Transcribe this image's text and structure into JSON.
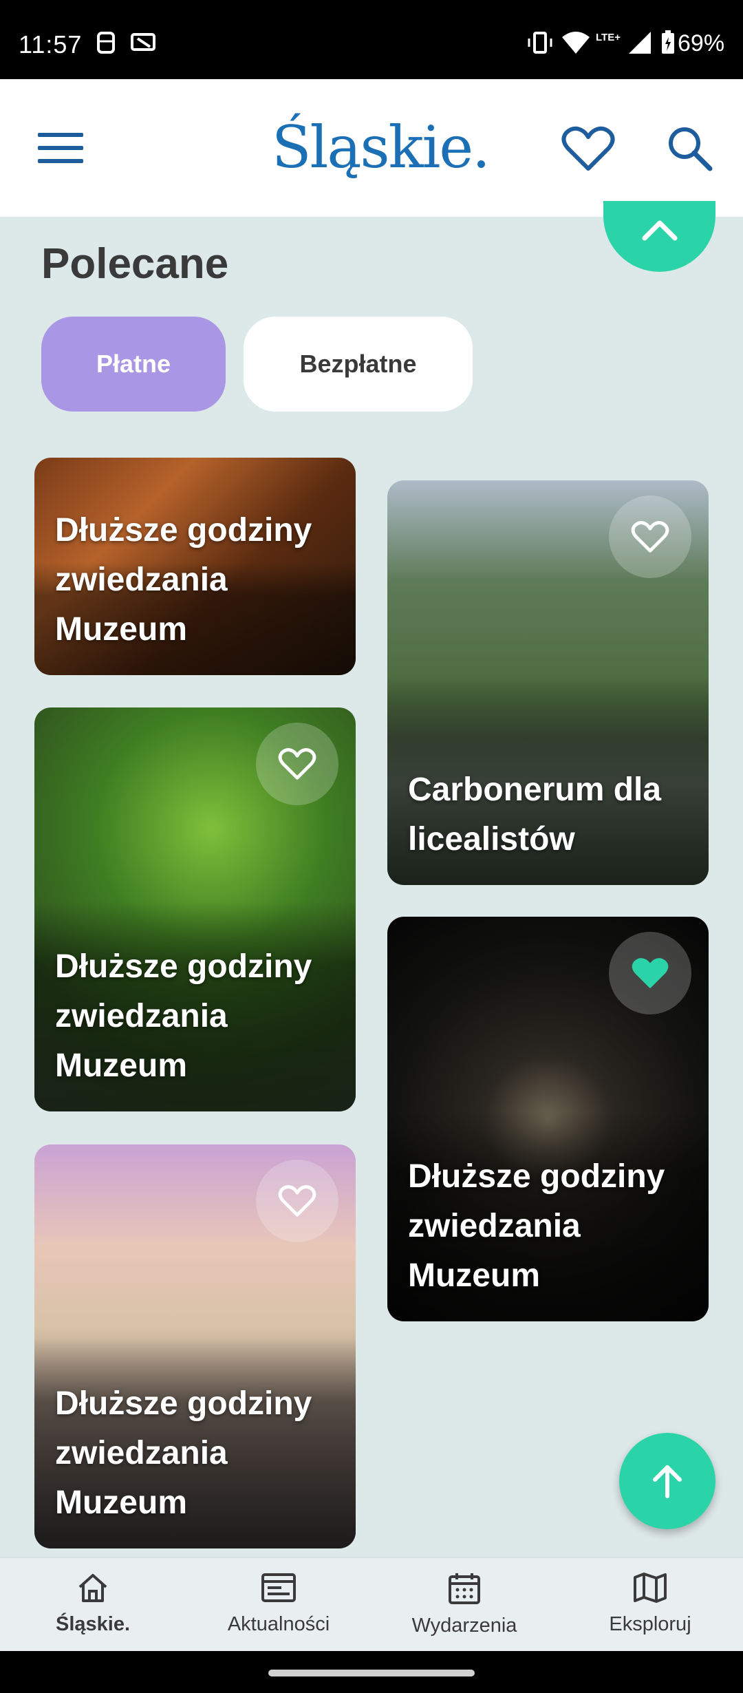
{
  "status_bar": {
    "time": "11:57",
    "network": "LTE+",
    "battery": "69%"
  },
  "header": {
    "logo": "Śląskie."
  },
  "section": {
    "title": "Polecane"
  },
  "filters": {
    "paid": "Płatne",
    "free": "Bezpłatne"
  },
  "cards": [
    {
      "title": "Dłuższe godziny zwiedzania Muzeum",
      "favorite": false
    },
    {
      "title": "Dłuższe godziny zwiedzania Muzeum",
      "favorite": false
    },
    {
      "title": "Dłuższe godziny zwiedzania Muzeum",
      "favorite": false
    },
    {
      "title": "Carbonerum dla licealistów",
      "favorite": false
    },
    {
      "title": "Dłuższe godziny zwiedzania Muzeum",
      "favorite": true
    }
  ],
  "bottom_nav": [
    {
      "label": "Śląskie.",
      "icon": "home-icon"
    },
    {
      "label": "Aktualności",
      "icon": "news-icon"
    },
    {
      "label": "Wydarzenia",
      "icon": "calendar-icon"
    },
    {
      "label": "Eksploruj",
      "icon": "map-icon"
    }
  ],
  "colors": {
    "brand_blue": "#1a6fb5",
    "accent_green": "#2bd4a8",
    "chip_active": "#a997e5",
    "background": "#dde8e8"
  }
}
